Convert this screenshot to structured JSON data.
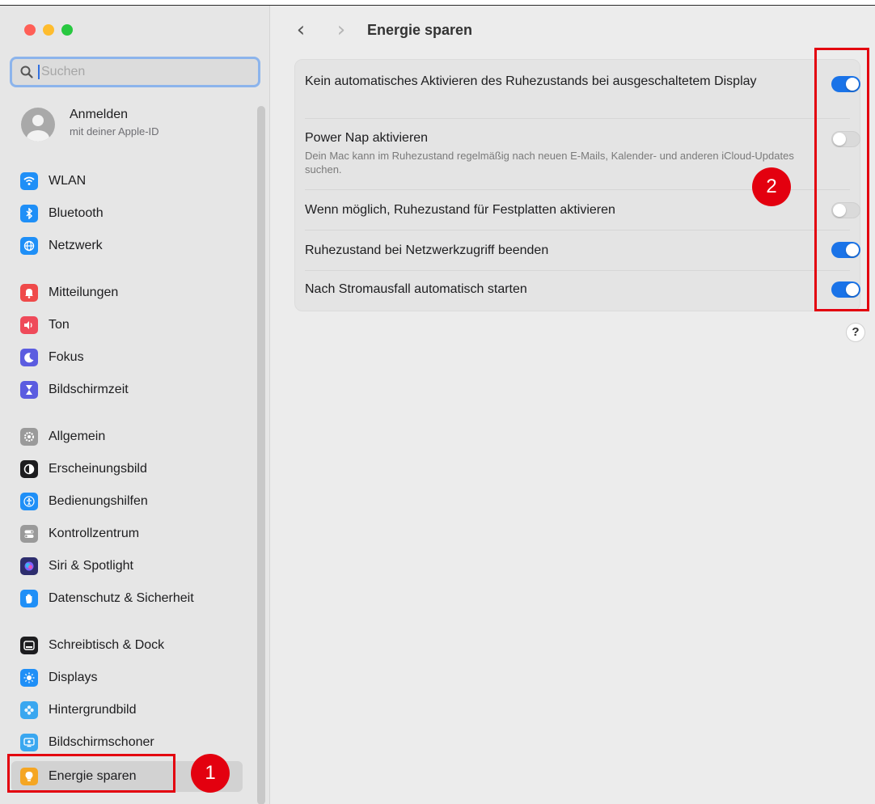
{
  "sidebar": {
    "search": {
      "value": "",
      "placeholder": "Suchen"
    },
    "apple_id": {
      "name": "Anmelden",
      "sub": "mit deiner Apple-ID"
    },
    "items": [
      {
        "label": "WLAN",
        "icon": "wifi-icon",
        "color": "#1f8ff7"
      },
      {
        "label": "Bluetooth",
        "icon": "bluetooth-icon",
        "color": "#1f8ff7"
      },
      {
        "label": "Netzwerk",
        "icon": "globe-icon",
        "color": "#1f8ff7"
      },
      {
        "label": "Mitteilungen",
        "icon": "bell-icon",
        "color": "#ef4a4a"
      },
      {
        "label": "Ton",
        "icon": "speaker-icon",
        "color": "#ef4a5a"
      },
      {
        "label": "Fokus",
        "icon": "moon-icon",
        "color": "#5b5ce0"
      },
      {
        "label": "Bildschirmzeit",
        "icon": "hourglass-icon",
        "color": "#5b5ce0"
      },
      {
        "label": "Allgemein",
        "icon": "gear-icon",
        "color": "#9a9a9a"
      },
      {
        "label": "Erscheinungsbild",
        "icon": "appearance-icon",
        "color": "#1d1d1f"
      },
      {
        "label": "Bedienungshilfen",
        "icon": "accessibility-icon",
        "color": "#1f8ff7"
      },
      {
        "label": "Kontrollzentrum",
        "icon": "switches-icon",
        "color": "#9a9a9a"
      },
      {
        "label": "Siri & Spotlight",
        "icon": "siri-icon",
        "color": "#2d2d6e"
      },
      {
        "label": "Datenschutz & Sicherheit",
        "icon": "hand-icon",
        "color": "#1f8ff7"
      },
      {
        "label": "Schreibtisch & Dock",
        "icon": "dock-icon",
        "color": "#1d1d1f"
      },
      {
        "label": "Displays",
        "icon": "sun-icon",
        "color": "#1f8ff7"
      },
      {
        "label": "Hintergrundbild",
        "icon": "flower-icon",
        "color": "#3aa7f0"
      },
      {
        "label": "Bildschirmschoner",
        "icon": "screensaver-icon",
        "color": "#3aa7f0"
      },
      {
        "label": "Energie sparen",
        "icon": "bulb-icon",
        "color": "#f5a623"
      }
    ]
  },
  "main": {
    "title": "Energie sparen",
    "back_glyph": "‹",
    "forward_glyph": "›",
    "rows": [
      {
        "label": "Kein automatisches Aktivieren des Ruhezustands bei ausgeschaltetem Display",
        "desc": "",
        "on": true
      },
      {
        "label": "Power Nap aktivieren",
        "desc": "Dein Mac kann im Ruhezustand regelmäßig nach neuen E-Mails, Kalender- und anderen iCloud-Updates suchen.",
        "on": false
      },
      {
        "label": "Wenn möglich, Ruhezustand für Festplatten aktivieren",
        "desc": "",
        "on": false
      },
      {
        "label": "Ruhezustand bei Netzwerkzugriff beenden",
        "desc": "",
        "on": true
      },
      {
        "label": "Nach Stromausfall automatisch starten",
        "desc": "",
        "on": true
      }
    ],
    "help_label": "?"
  },
  "annotations": {
    "badge1": "1",
    "badge2": "2"
  }
}
